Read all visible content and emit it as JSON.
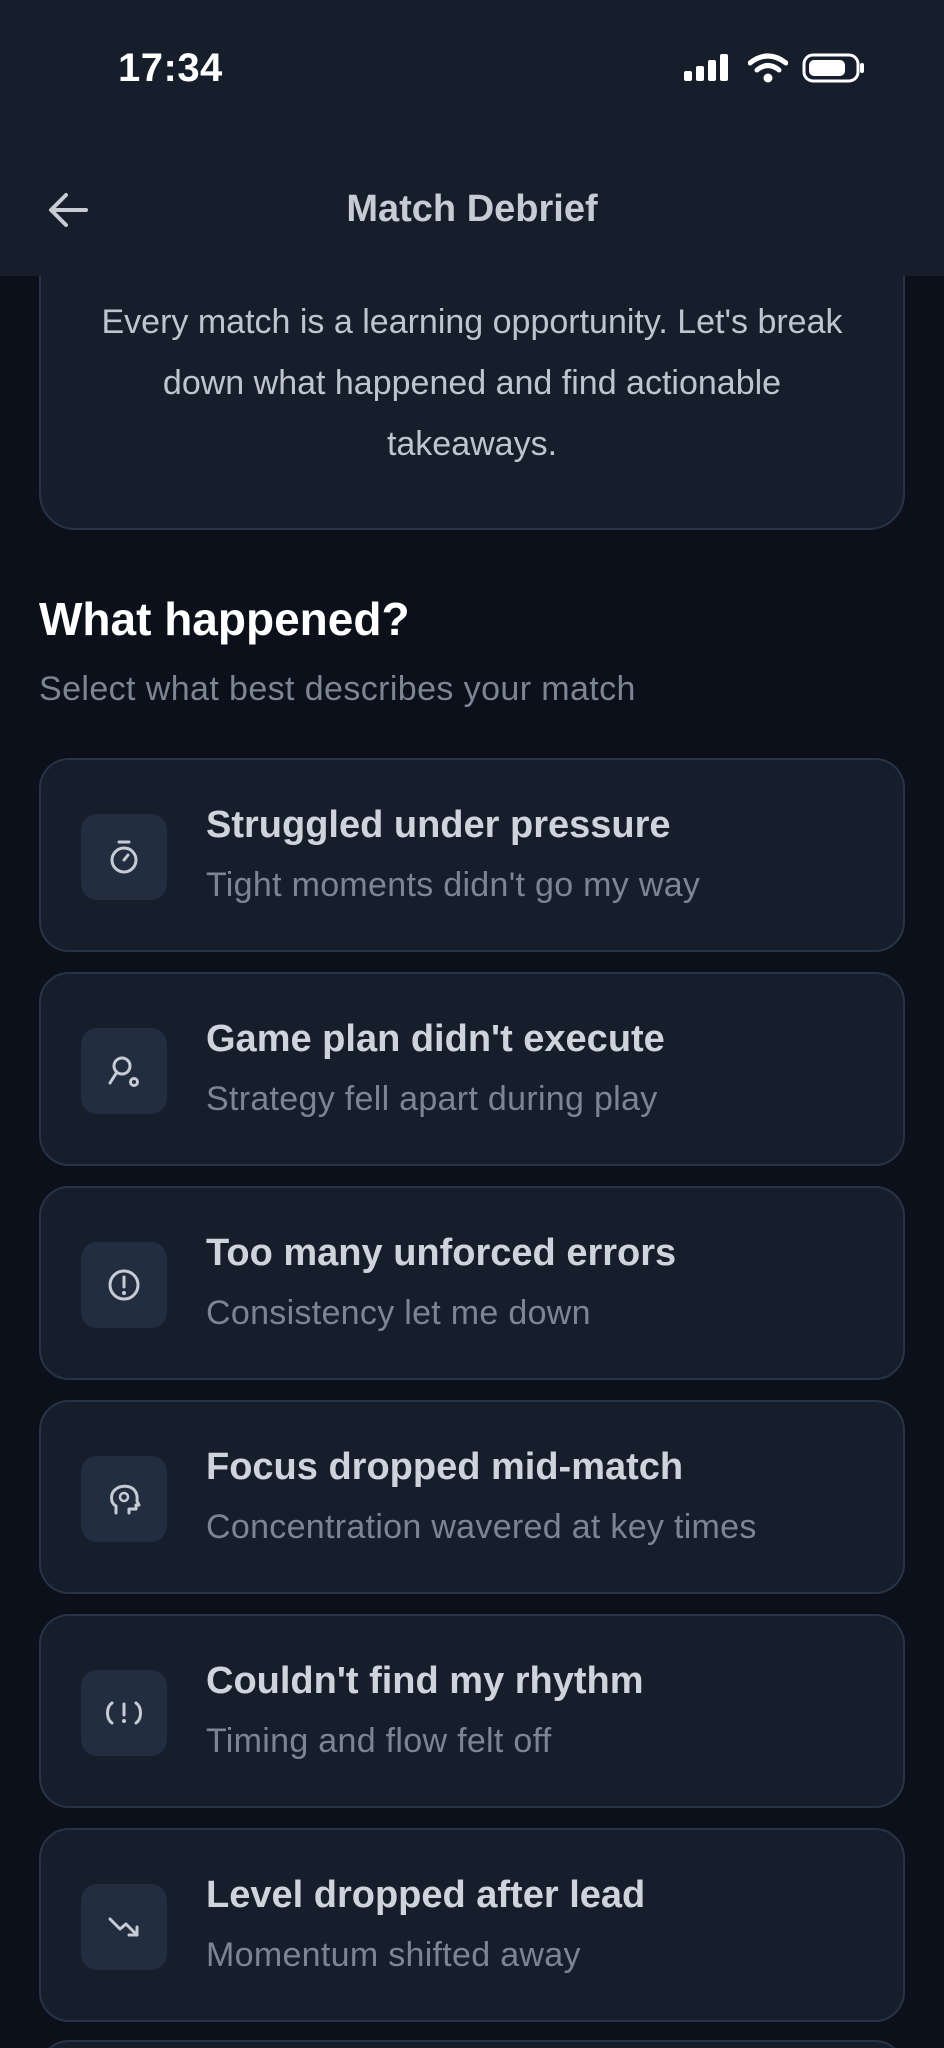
{
  "status_bar": {
    "time": "17:34"
  },
  "header": {
    "title": "Match Debrief"
  },
  "intro": {
    "text": "Every match is a learning opportunity. Let's break down what happened and find actionable takeaways."
  },
  "section": {
    "title": "What happened?",
    "subtitle": "Select what best describes your match"
  },
  "options": [
    {
      "icon": "timer-icon",
      "title": "Struggled under pressure",
      "description": "Tight moments didn't go my way"
    },
    {
      "icon": "route-icon",
      "title": "Game plan didn't execute",
      "description": "Strategy fell apart during play"
    },
    {
      "icon": "alert-circle-icon",
      "title": "Too many unforced errors",
      "description": "Consistency let me down"
    },
    {
      "icon": "brain-icon",
      "title": "Focus dropped mid-match",
      "description": "Concentration wavered at key times"
    },
    {
      "icon": "rhythm-icon",
      "title": "Couldn't find my rhythm",
      "description": "Timing and flow felt off"
    },
    {
      "icon": "trend-down-icon",
      "title": "Level dropped after lead",
      "description": "Momentum shifted away"
    }
  ],
  "colors": {
    "background": "#0b101b",
    "surface": "#161e2c",
    "border": "#273447",
    "icon_tile": "#222d40",
    "text_primary": "#cfd4dc",
    "text_secondary": "#7c8594"
  }
}
